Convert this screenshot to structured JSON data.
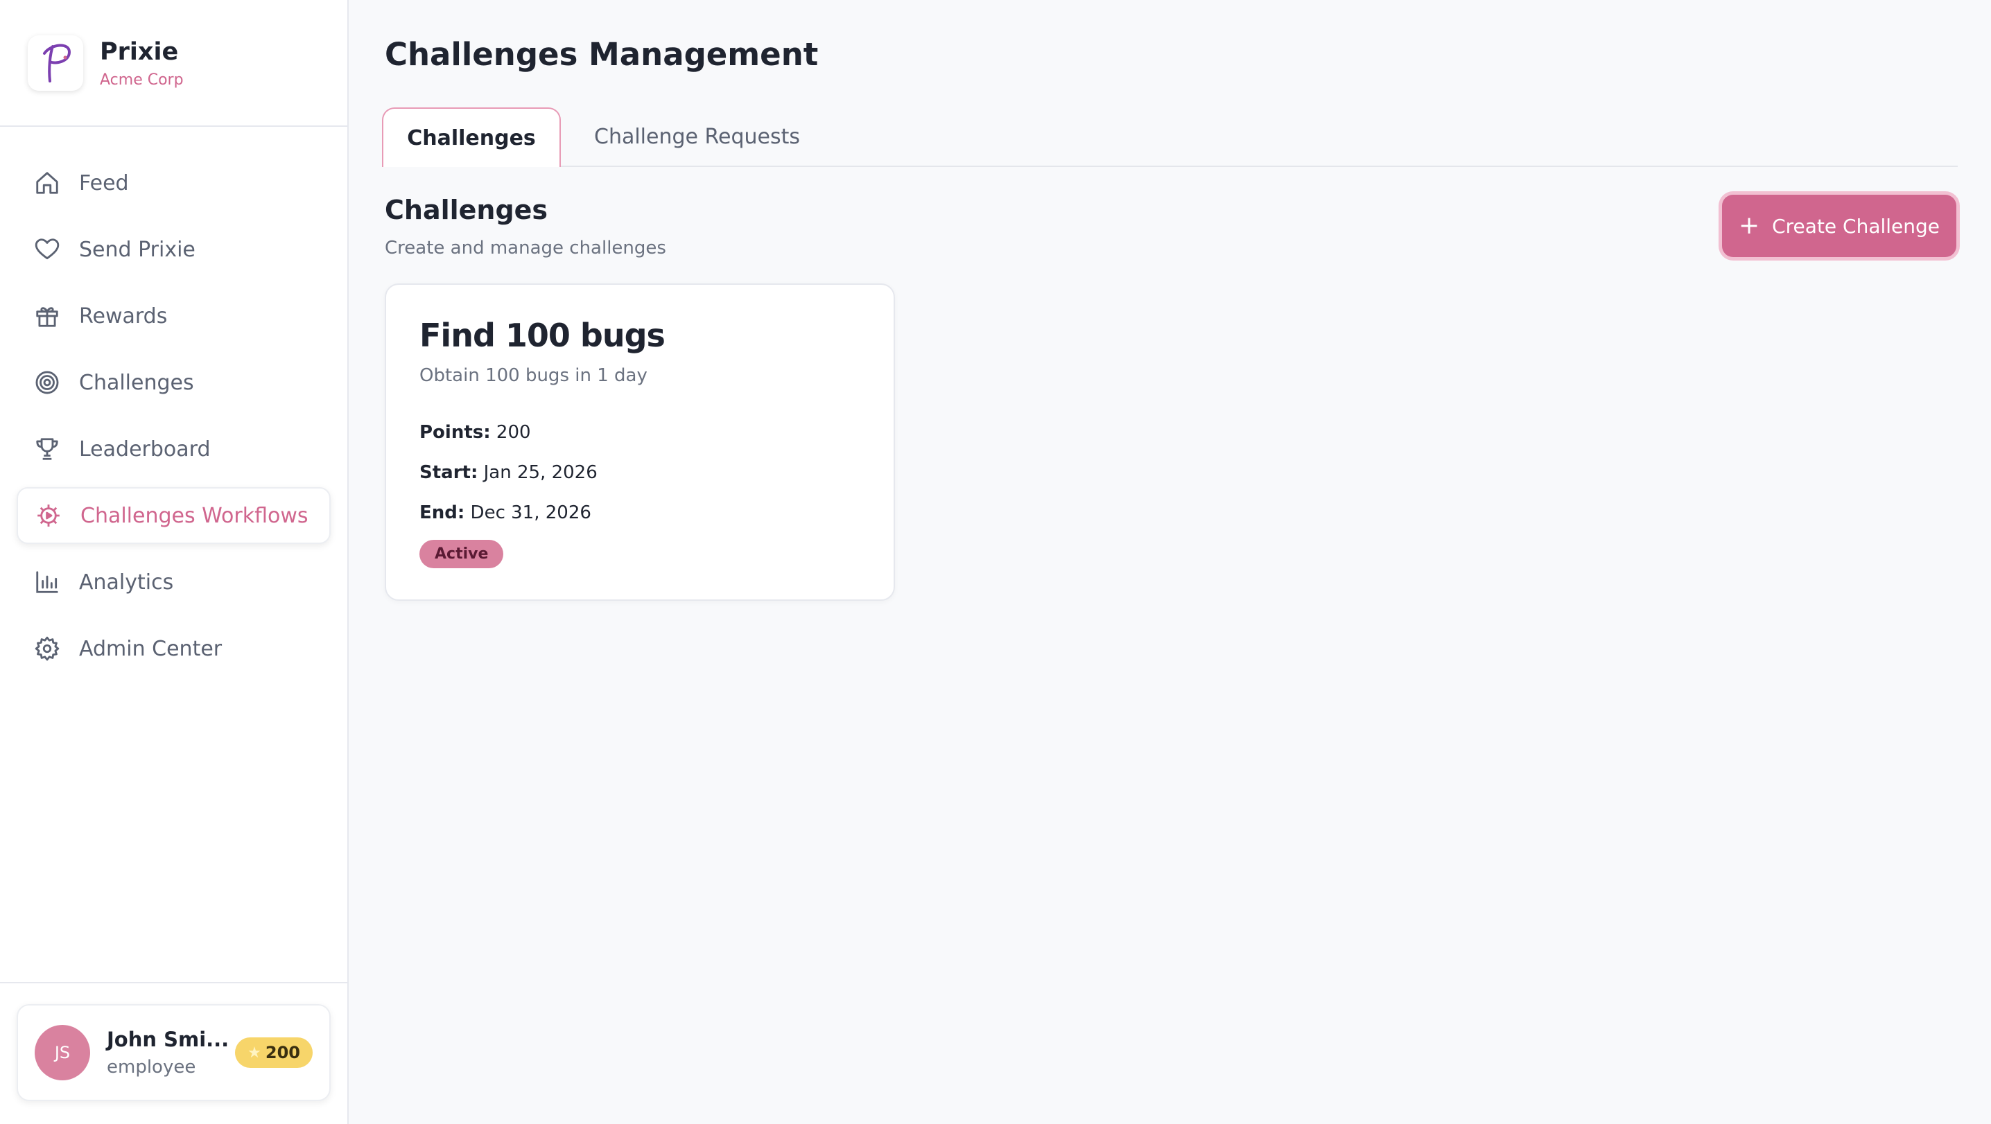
{
  "brand": {
    "name": "Prixie",
    "org": "Acme Corp",
    "accent": "#d0668e"
  },
  "nav": {
    "items": [
      {
        "label": "Feed",
        "icon": "home-icon"
      },
      {
        "label": "Send Prixie",
        "icon": "heart-icon"
      },
      {
        "label": "Rewards",
        "icon": "gift-icon"
      },
      {
        "label": "Challenges",
        "icon": "target-icon"
      },
      {
        "label": "Leaderboard",
        "icon": "trophy-icon"
      },
      {
        "label": "Challenges Workflows",
        "icon": "gear-icon",
        "active": true
      },
      {
        "label": "Analytics",
        "icon": "bar-chart-icon"
      },
      {
        "label": "Admin Center",
        "icon": "settings-icon"
      }
    ]
  },
  "user": {
    "initials": "JS",
    "name": "John Smi...",
    "role": "employee",
    "points": "200"
  },
  "page": {
    "title": "Challenges Management"
  },
  "tabs": [
    {
      "label": "Challenges",
      "active": true
    },
    {
      "label": "Challenge Requests",
      "active": false
    }
  ],
  "section": {
    "title": "Challenges",
    "subtitle": "Create and manage challenges",
    "create_label": "Create Challenge"
  },
  "challenges": [
    {
      "title": "Find 100 bugs",
      "description": "Obtain 100 bugs in 1 day",
      "points_label": "Points:",
      "points": "200",
      "start_label": "Start:",
      "start": "Jan 25, 2026",
      "end_label": "End:",
      "end": "Dec 31, 2026",
      "status": "Active"
    }
  ]
}
